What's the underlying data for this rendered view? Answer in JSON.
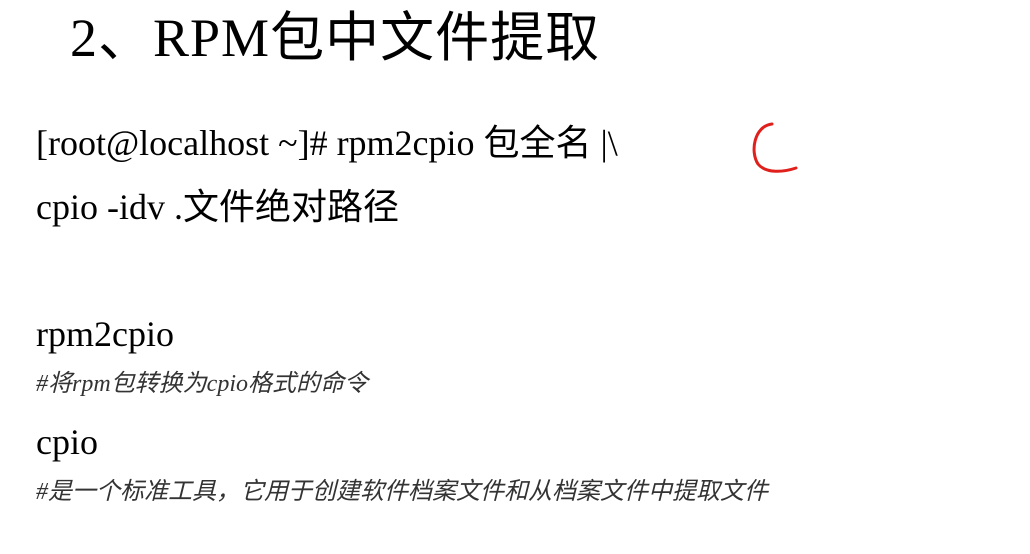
{
  "title": "2、RPM包中文件提取",
  "command": {
    "line1": "[root@localhost ~]# rpm2cpio 包全名 |\\",
    "line2": "cpio -idv .文件绝对路径"
  },
  "definitions": [
    {
      "term": "rpm2cpio",
      "comment": "#将rpm包转换为cpio格式的命令"
    },
    {
      "term": "cpio",
      "comment": "#是一个标准工具，它用于创建软件档案文件和从档案文件中提取文件"
    }
  ],
  "annotation": {
    "color": "#e0201c"
  }
}
